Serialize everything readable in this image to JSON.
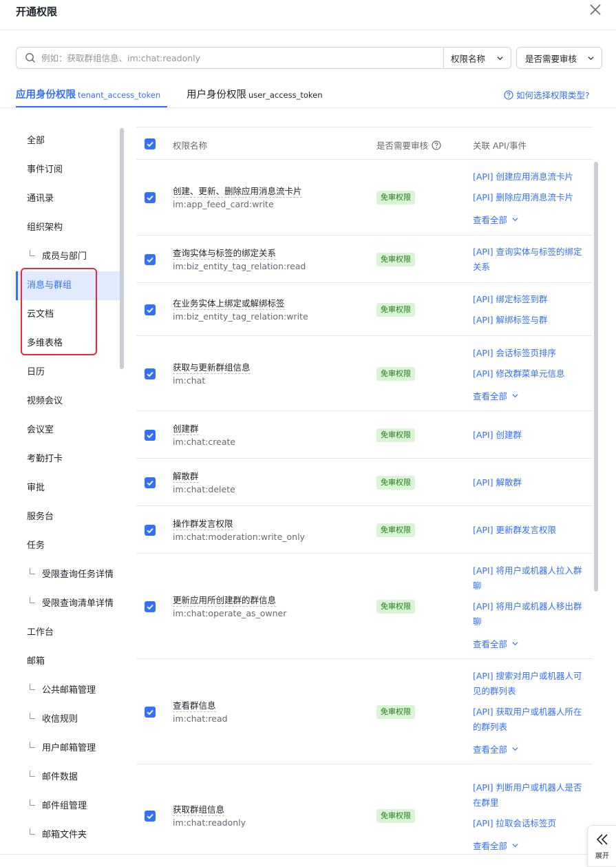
{
  "modal": {
    "title": "开通权限"
  },
  "search": {
    "placeholder": "例如：获取群组信息、im:chat:readonly",
    "select_label": "权限名称",
    "filter_label": "是否需要审核"
  },
  "tabs": [
    {
      "label": "应用身份权限",
      "token": "tenant_access_token"
    },
    {
      "label": "用户身份权限",
      "token": "user_access_token"
    }
  ],
  "help_link": "如何选择权限类型?",
  "sidebar": {
    "items": [
      {
        "label": "全部",
        "sub": false
      },
      {
        "label": "事件订阅",
        "sub": false
      },
      {
        "label": "通讯录",
        "sub": false
      },
      {
        "label": "组织架构",
        "sub": false
      },
      {
        "label": "成员与部门",
        "sub": true
      },
      {
        "label": "消息与群组",
        "sub": false
      },
      {
        "label": "云文档",
        "sub": false
      },
      {
        "label": "多维表格",
        "sub": false
      },
      {
        "label": "日历",
        "sub": false
      },
      {
        "label": "视频会议",
        "sub": false
      },
      {
        "label": "会议室",
        "sub": false
      },
      {
        "label": "考勤打卡",
        "sub": false
      },
      {
        "label": "审批",
        "sub": false
      },
      {
        "label": "服务台",
        "sub": false
      },
      {
        "label": "任务",
        "sub": false
      },
      {
        "label": "受限查询任务详情",
        "sub": true
      },
      {
        "label": "受限查询清单详情",
        "sub": true
      },
      {
        "label": "工作台",
        "sub": false
      },
      {
        "label": "邮箱",
        "sub": false
      },
      {
        "label": "公共邮箱管理",
        "sub": true
      },
      {
        "label": "收信规则",
        "sub": true
      },
      {
        "label": "用户邮箱管理",
        "sub": true
      },
      {
        "label": "邮件数据",
        "sub": true
      },
      {
        "label": "邮件组管理",
        "sub": true
      },
      {
        "label": "邮箱文件夹",
        "sub": true
      }
    ]
  },
  "table": {
    "headers": {
      "name": "权限名称",
      "review": "是否需要审核",
      "api": "关联 API/事件"
    },
    "more_label": "查看全部",
    "rows": [
      {
        "name": "创建、更新、删除应用消息流卡片",
        "code": "im:app_feed_card:write",
        "badge": "免审权限",
        "apis": [
          "[API] 创建应用消息流卡片",
          "[API] 删除应用消息流卡片"
        ],
        "more": true
      },
      {
        "name": "查询实体与标签的绑定关系",
        "code": "im:biz_entity_tag_relation:read",
        "badge": "免审权限",
        "apis": [
          "[API] 查询实体与标签的绑定关系"
        ],
        "more": false
      },
      {
        "name": "在业务实体上绑定或解绑标签",
        "code": "im:biz_entity_tag_relation:write",
        "badge": "免审权限",
        "apis": [
          "[API] 绑定标签到群",
          "[API] 解绑标签与群"
        ],
        "more": false
      },
      {
        "name": "获取与更新群组信息",
        "code": "im:chat",
        "badge": "免审权限",
        "apis": [
          "[API] 会话标签页排序",
          "[API] 修改群菜单元信息"
        ],
        "more": true
      },
      {
        "name": "创建群",
        "code": "im:chat:create",
        "badge": "免审权限",
        "apis": [
          "[API] 创建群"
        ],
        "more": false
      },
      {
        "name": "解散群",
        "code": "im:chat:delete",
        "badge": "免审权限",
        "apis": [
          "[API] 解散群"
        ],
        "more": false
      },
      {
        "name": "操作群发言权限",
        "code": "im:chat:moderation:write_only",
        "badge": "免审权限",
        "apis": [
          "[API] 更新群发言权限"
        ],
        "more": false
      },
      {
        "name": "更新应用所创建群的群信息",
        "code": "im:chat:operate_as_owner",
        "badge": "免审权限",
        "apis": [
          "[API] 将用户或机器人拉入群聊",
          "[API] 将用户或机器人移出群聊"
        ],
        "more": true
      },
      {
        "name": "查看群信息",
        "code": "im:chat:read",
        "badge": "免审权限",
        "apis": [
          "[API] 搜索对用户或机器人可见的群列表",
          "[API] 获取用户或机器人所在的群列表"
        ],
        "more": true
      },
      {
        "name": "获取群组信息",
        "code": "im:chat:readonly",
        "badge": "免审权限",
        "apis": [
          "[API] 判断用户或机器人是否在群里",
          "[API] 拉取会话标签页"
        ],
        "more": true
      }
    ]
  },
  "expand_label": "展开",
  "colors": {
    "accent": "#3370ff",
    "badge_bg": "#d9f5d6",
    "badge_text": "#237b19",
    "highlight": "#e9293b"
  }
}
